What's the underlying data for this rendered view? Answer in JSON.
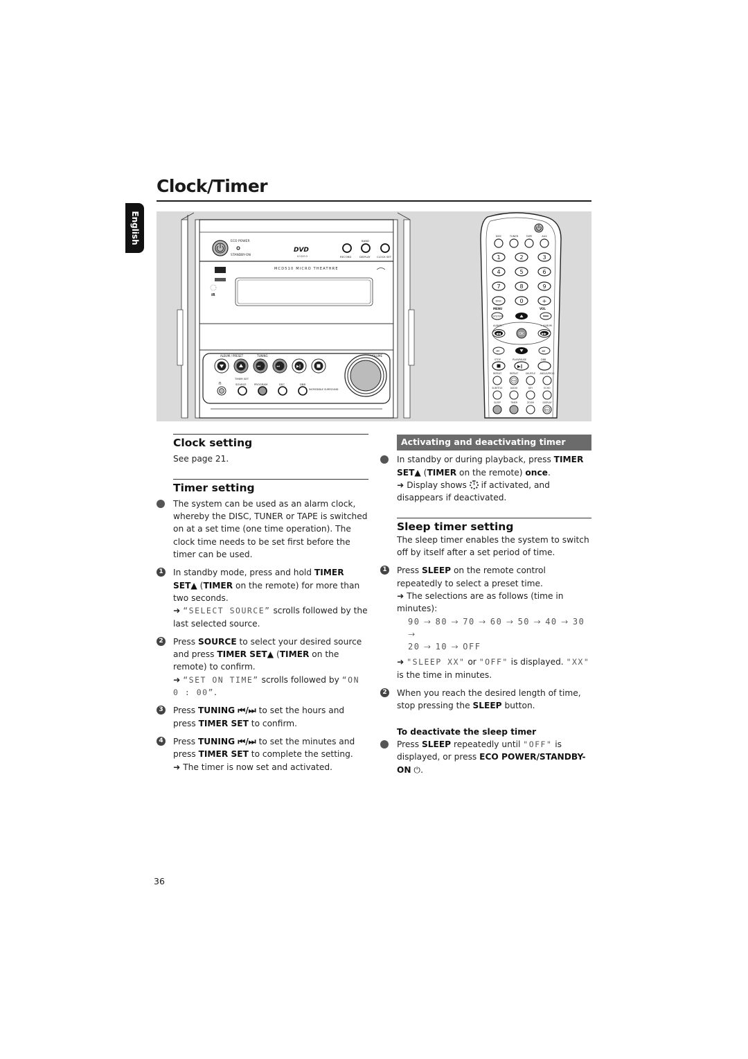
{
  "page": {
    "title": "Clock/Timer",
    "language_tab": "English",
    "page_number": "36"
  },
  "illustration": {
    "main_unit": {
      "model_label": "MCD510 MICRO THEATHRE",
      "dvd_logo": "DVD",
      "dvd_sub": "VIDEO",
      "labels": {
        "eco_power": "ECO POWER",
        "standby_on": "STANDBY-ON",
        "record": "RECORD",
        "band": "BAND",
        "display": "DISPLAY",
        "clock_set": "CLOCK SET",
        "ir": "iR",
        "album_preset": "ALBUM / PRESET",
        "tuning": "TUNING",
        "timer_set": "TIMER SET",
        "volume": "VOLUME",
        "source": "SOURCE",
        "program": "PROGRAM",
        "dsc": "DSC",
        "dbb": "DBB",
        "incredible_surround": "INCREDIBLE SURROUND"
      }
    },
    "remote": {
      "source_buttons": [
        "DISC",
        "TUNER",
        "TAPE",
        "AUX"
      ],
      "number_buttons": [
        "1",
        "2",
        "3",
        "4",
        "5",
        "6",
        "7",
        "8",
        "9",
        "DISC",
        "0",
        "+"
      ],
      "labels": {
        "menu": "MENU",
        "vol": "VOL",
        "system": "SYSTEM",
        "album_left": "ALBUM -",
        "album_right": "+ ALBUM",
        "ok": "OK",
        "stop": "STOP",
        "play_pause": "PLAY/PAUSE",
        "dbb": "DBB",
        "repeat": "REPEAT",
        "repeat_ab": "REPEAT",
        "ab": "A-B",
        "shuffle": "SHUFFLE",
        "angle_prog": "ANGLE/PROG",
        "subtitle": "SUBTITLE",
        "audio": "AUDIO",
        "key": "KEY",
        "echo": "ECHO",
        "sleep": "SLEEP",
        "timer": "TIMER",
        "zoom": "ZOOM",
        "display": "DISPLAY",
        "dsc": "DSC"
      }
    }
  },
  "left_column": {
    "clock_setting": {
      "title": "Clock setting",
      "text": "See page 21."
    },
    "timer_setting": {
      "title": "Timer setting",
      "intro": "The system can be used as an alarm clock, whereby the DISC, TUNER or TAPE is switched on at a set time (one time operation). The clock time needs to be set first before the timer can be used.",
      "steps": [
        {
          "num": "1",
          "pre": "In standby mode, press and hold ",
          "b1": "TIMER SET▲",
          "mid1": " (",
          "b2": "TIMER",
          "post": " on the remote) for more than two seconds.",
          "result_lcd": "“SELECT SOURCE”",
          "result_text": " scrolls followed by the last selected source."
        },
        {
          "num": "2",
          "pre": "Press ",
          "b1": "SOURCE",
          "mid1": " to select your desired source and press ",
          "b2": "TIMER SET▲",
          "mid2": " (",
          "b3": "TIMER",
          "post": " on the remote) to confirm.",
          "result_lcd": "“SET ON TIME”",
          "result_text": " scrolls followed by ",
          "result_lcd2": "“ON 0 : 00”",
          "result_end": "."
        },
        {
          "num": "3",
          "pre": "Press ",
          "b1": "TUNING ⏮/⏭",
          "mid1": " to set the hours and press ",
          "b2": "TIMER SET",
          "post": " to confirm."
        },
        {
          "num": "4",
          "pre": "Press ",
          "b1": "TUNING ⏮/⏭",
          "mid1": "  to set the minutes and press ",
          "b2": "TIMER SET",
          "post": " to complete the setting.",
          "result_text": "The timer is now set and activated."
        }
      ]
    }
  },
  "right_column": {
    "activating": {
      "banner": "Activating and deactivating timer",
      "pre": "In standby or during playback, press ",
      "b1": "TIMER SET▲",
      "mid1": " (",
      "b2": "TIMER",
      "mid2": " on the remote) ",
      "b3": "once",
      "post": ".",
      "result_pre": "Display shows ",
      "result_icon": "timer-clock",
      "result_post": " if activated, and disappears if deactivated."
    },
    "sleep_timer": {
      "title": "Sleep timer setting",
      "intro": "The sleep timer enables the system to switch off by itself after a set period of time.",
      "steps": [
        {
          "num": "1",
          "pre": "Press ",
          "b1": "SLEEP",
          "post": " on the remote control repeatedly to select a preset time.",
          "result_text": "The selections are as follows (time in minutes):",
          "sequence": [
            "90",
            "80",
            "70",
            "60",
            "50",
            "40",
            "30",
            "20",
            "10",
            "OFF"
          ],
          "result2_lcd1": "\"SLEEP XX\"",
          "result2_mid": " or ",
          "result2_lcd2": "\"OFF\"",
          "result2_mid2": " is displayed. ",
          "result2_lcd3": "\"XX\"",
          "result2_end": " is the time in minutes."
        },
        {
          "num": "2",
          "pre": "When you reach the desired length of time, stop pressing the ",
          "b1": "SLEEP",
          "post": " button."
        }
      ],
      "deactivate": {
        "heading": "To deactivate the sleep timer",
        "pre": "Press ",
        "b1": "SLEEP",
        "mid1": " repeatedly until ",
        "lcd": "\"OFF\"",
        "mid2": " is displayed, or press ",
        "b2": "ECO POWER/STANDBY-ON",
        "post": " ⏻."
      }
    }
  }
}
